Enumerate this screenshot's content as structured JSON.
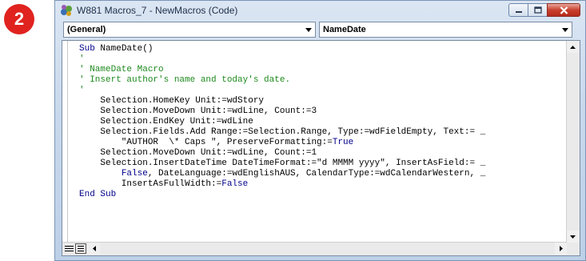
{
  "step_badge": "2",
  "window": {
    "title": "W881 Macros_7 - NewMacros (Code)"
  },
  "object_combo": {
    "value": "(General)"
  },
  "procedure_combo": {
    "value": "NameDate"
  },
  "code_lines": [
    [
      {
        "t": "Sub",
        "c": "kw"
      },
      {
        "t": " NameDate()",
        "c": ""
      }
    ],
    [
      {
        "t": "'",
        "c": "cm"
      }
    ],
    [
      {
        "t": "' NameDate Macro",
        "c": "cm"
      }
    ],
    [
      {
        "t": "' Insert author's name and today's date.",
        "c": "cm"
      }
    ],
    [
      {
        "t": "'",
        "c": "cm"
      }
    ],
    [
      {
        "t": "    Selection.HomeKey Unit:=wdStory",
        "c": ""
      }
    ],
    [
      {
        "t": "    Selection.MoveDown Unit:=wdLine, Count:=3",
        "c": ""
      }
    ],
    [
      {
        "t": "    Selection.EndKey Unit:=wdLine",
        "c": ""
      }
    ],
    [
      {
        "t": "    Selection.Fields.Add Range:=Selection.Range, Type:=wdFieldEmpty, Text:= _",
        "c": ""
      }
    ],
    [
      {
        "t": "        \"AUTHOR  \\* Caps \", PreserveFormatting:=",
        "c": ""
      },
      {
        "t": "True",
        "c": "kw"
      }
    ],
    [
      {
        "t": "    Selection.MoveDown Unit:=wdLine, Count:=1",
        "c": ""
      }
    ],
    [
      {
        "t": "    Selection.InsertDateTime DateTimeFormat:=\"d MMMM yyyy\", InsertAsField:= _",
        "c": ""
      }
    ],
    [
      {
        "t": "        ",
        "c": ""
      },
      {
        "t": "False",
        "c": "kw"
      },
      {
        "t": ", DateLanguage:=wdEnglishAUS, CalendarType:=wdCalendarWestern, _",
        "c": ""
      }
    ],
    [
      {
        "t": "        InsertAsFullWidth:=",
        "c": ""
      },
      {
        "t": "False",
        "c": "kw"
      }
    ],
    [
      {
        "t": "End Sub",
        "c": "kw"
      }
    ]
  ],
  "colors": {
    "keyword": "#00008b",
    "comment": "#1e8a1e",
    "badge": "#e0231f"
  },
  "icons": [
    "word-macro-app-icon",
    "minimize-icon",
    "maximize-icon",
    "close-icon",
    "dropdown-arrow-icon",
    "scroll-up-icon",
    "scroll-down-icon",
    "scroll-left-icon",
    "scroll-right-icon",
    "procedure-view-icon",
    "full-module-view-icon"
  ]
}
